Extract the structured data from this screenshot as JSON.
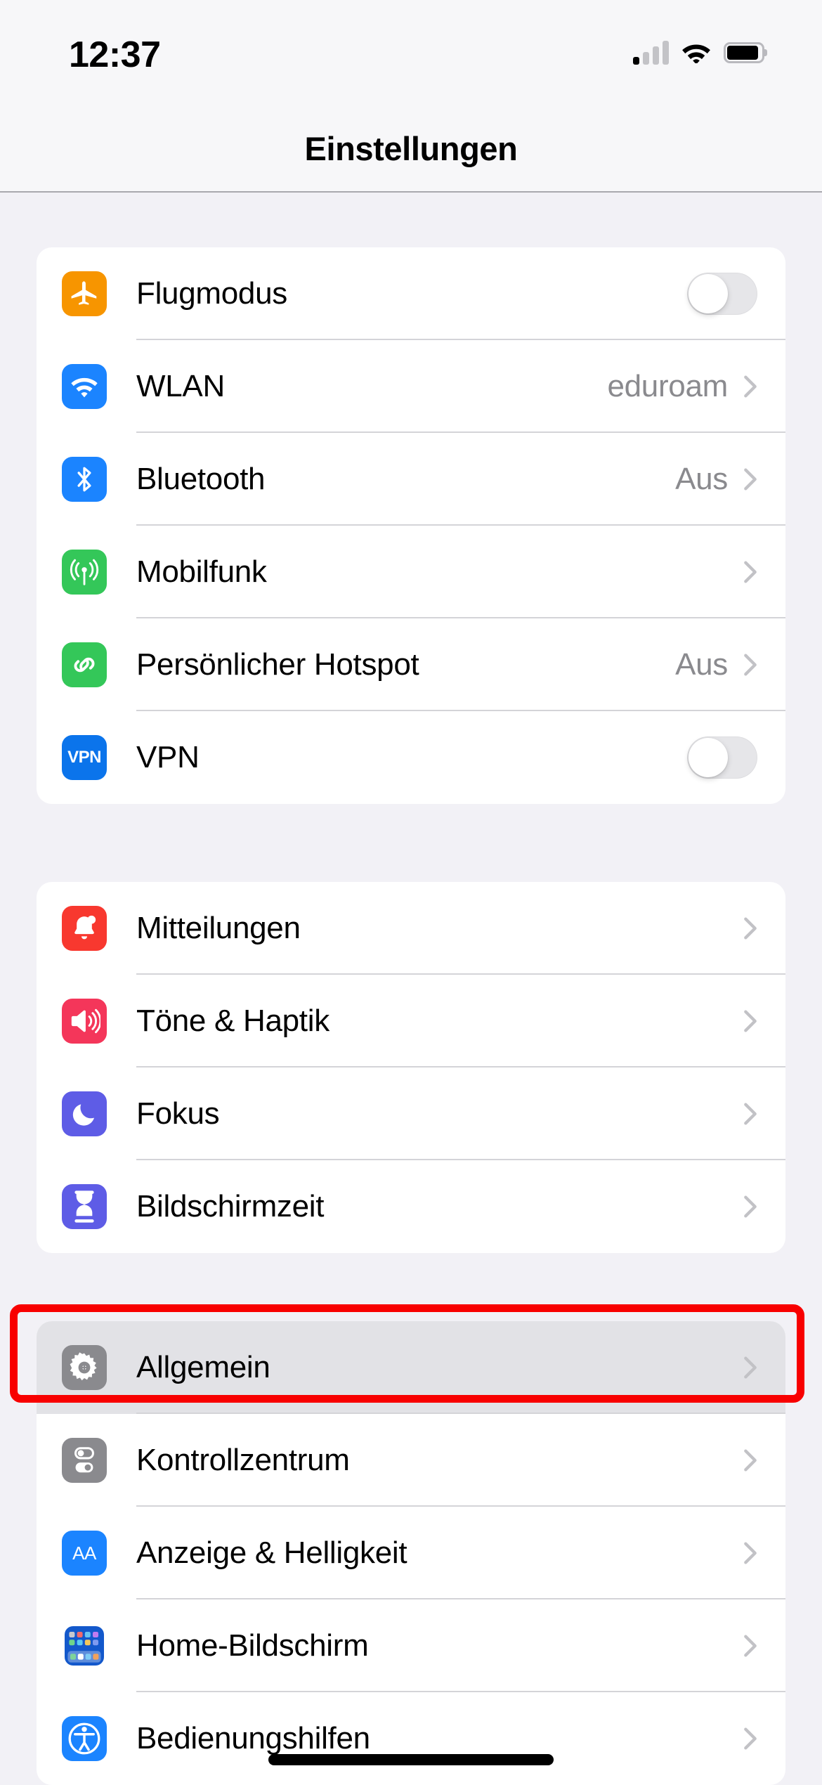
{
  "status_bar": {
    "time": "12:37",
    "cellular_icon": "cellular-signal-icon",
    "cellular_bars_total": 4,
    "cellular_bars_active": 1,
    "wifi_icon": "wifi-icon",
    "wifi_strength": "full",
    "battery_icon": "battery-icon",
    "battery_level_percent": 85
  },
  "navbar": {
    "title": "Einstellungen"
  },
  "groups": [
    {
      "id": "connectivity",
      "rows": [
        {
          "id": "airplane-mode",
          "label": "Flugmodus",
          "icon": "airplane-icon",
          "icon_color": "#F79500",
          "accessory": "toggle",
          "toggle_on": false
        },
        {
          "id": "wifi",
          "label": "WLAN",
          "icon": "wifi-icon",
          "icon_color": "#1B84FF",
          "accessory": "value",
          "value": "eduroam"
        },
        {
          "id": "bluetooth",
          "label": "Bluetooth",
          "icon": "bluetooth-icon",
          "icon_color": "#1B84FF",
          "accessory": "value",
          "value": "Aus"
        },
        {
          "id": "cellular",
          "label": "Mobilfunk",
          "icon": "antenna-icon",
          "icon_color": "#34C759",
          "accessory": "chevron",
          "value": ""
        },
        {
          "id": "hotspot",
          "label": "Persönlicher Hotspot",
          "icon": "hotspot-icon",
          "icon_color": "#34C759",
          "accessory": "value",
          "value": "Aus"
        },
        {
          "id": "vpn",
          "label": "VPN",
          "icon": "vpn-icon",
          "icon_color": "#0B74EB",
          "accessory": "toggle",
          "toggle_on": false
        }
      ]
    },
    {
      "id": "alerts",
      "rows": [
        {
          "id": "notifications",
          "label": "Mitteilungen",
          "icon": "bell-icon",
          "icon_color": "#F8382F",
          "accessory": "chevron",
          "value": ""
        },
        {
          "id": "sounds",
          "label": "Töne & Haptik",
          "icon": "speaker-icon",
          "icon_color": "#F4365A",
          "accessory": "chevron",
          "value": ""
        },
        {
          "id": "focus",
          "label": "Fokus",
          "icon": "moon-icon",
          "icon_color": "#5E5CE6",
          "accessory": "chevron",
          "value": ""
        },
        {
          "id": "screen-time",
          "label": "Bildschirmzeit",
          "icon": "hourglass-icon",
          "icon_color": "#5E5CE6",
          "accessory": "chevron",
          "value": ""
        }
      ]
    },
    {
      "id": "system",
      "rows": [
        {
          "id": "general",
          "label": "Allgemein",
          "icon": "gear-icon",
          "icon_color": "#8A8A8E",
          "accessory": "chevron",
          "value": "",
          "selected": true
        },
        {
          "id": "control-center",
          "label": "Kontrollzentrum",
          "icon": "toggles-icon",
          "icon_color": "#8A8A8E",
          "accessory": "chevron",
          "value": ""
        },
        {
          "id": "display",
          "label": "Anzeige & Helligkeit",
          "icon": "aa-icon",
          "icon_color": "#1B84FF",
          "accessory": "chevron",
          "value": ""
        },
        {
          "id": "home-screen",
          "label": "Home-Bildschirm",
          "icon": "app-grid-icon",
          "icon_color": "#1358CB",
          "accessory": "chevron",
          "value": ""
        },
        {
          "id": "accessibility",
          "label": "Bedienungshilfen",
          "icon": "accessibility-icon",
          "icon_color": "#1B84FF",
          "accessory": "chevron",
          "value": ""
        }
      ]
    }
  ],
  "annotation": {
    "target_row_id": "general",
    "shape": "rectangle",
    "color": "#F80000"
  }
}
